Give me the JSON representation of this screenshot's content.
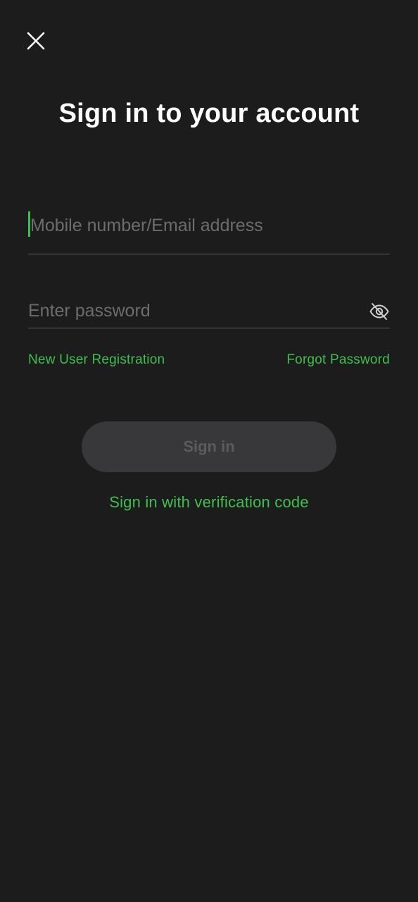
{
  "header": {
    "close_icon": "close-icon"
  },
  "title": "Sign in to your account",
  "account_field": {
    "value": "",
    "placeholder": "Mobile number/Email address",
    "focused": true,
    "accent_color": "#3fbf4f"
  },
  "password_field": {
    "value": "",
    "placeholder": "Enter password",
    "visibility_icon": "eye-off-icon"
  },
  "links": {
    "register": "New User Registration",
    "forgot": "Forgot Password"
  },
  "signin_button": {
    "label": "Sign in",
    "enabled": false
  },
  "alt_signin": "Sign in with verification code",
  "colors": {
    "background": "#1c1c1c",
    "accent": "#3fbf4f",
    "button_disabled_bg": "#38383a",
    "button_disabled_text": "#5b5b5d"
  }
}
